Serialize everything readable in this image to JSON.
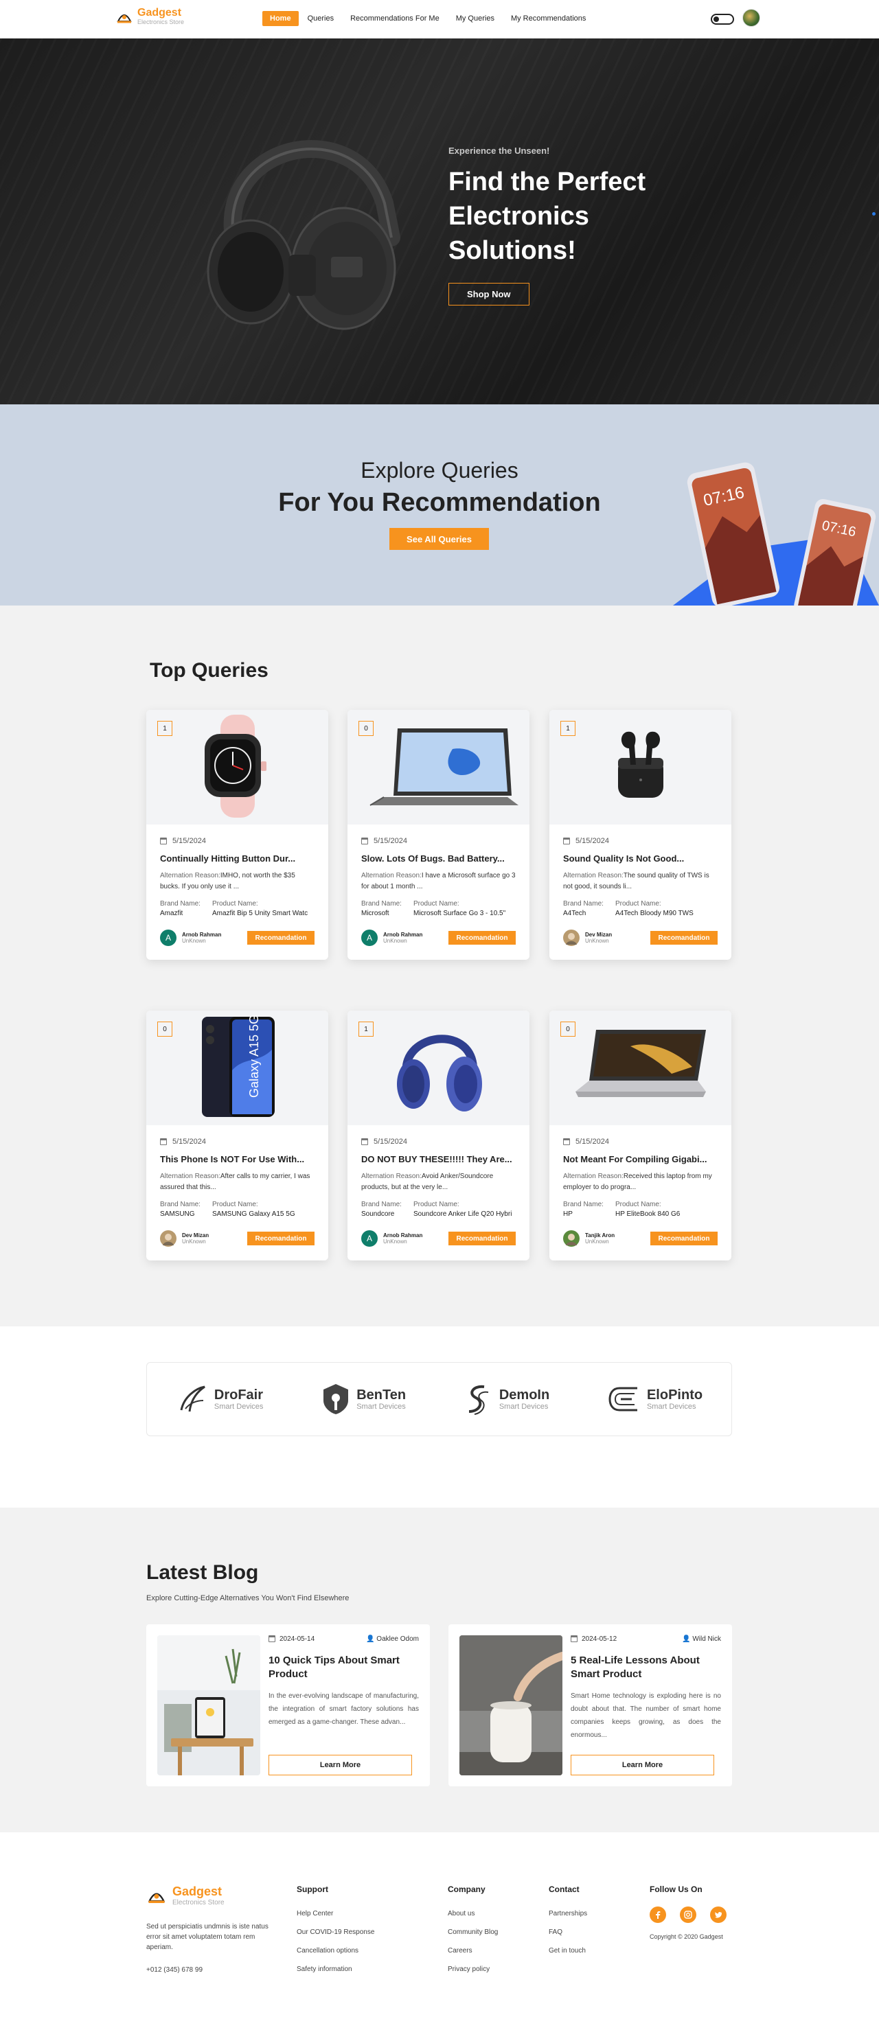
{
  "brand": {
    "name": "Gadgest",
    "tagline": "Electronics Store"
  },
  "nav": {
    "items": [
      {
        "label": "Home",
        "active": true
      },
      {
        "label": "Queries"
      },
      {
        "label": "Recommendations For Me"
      },
      {
        "label": "My Queries"
      },
      {
        "label": "My Recommendations"
      }
    ]
  },
  "hero": {
    "kicker": "Experience the Unseen!",
    "title": "Find the Perfect Electronics Solutions!",
    "button": "Shop Now"
  },
  "explore": {
    "subtitle": "Explore Queries",
    "title": "For You Recommendation",
    "button": "See All Queries",
    "phone_time": "07:16"
  },
  "queries": {
    "title": "Top Queries",
    "brand_label": "Brand Name:",
    "product_label": "Product Name:",
    "reason_label": "Alternation Reason:",
    "button_label": "Recomandation",
    "cards": [
      {
        "count": "1",
        "date": "5/15/2024",
        "title": "Continually Hitting Button Dur...",
        "reason": "IMHO, not worth the $35 bucks. If you only use it ...",
        "brand": "Amazfit",
        "product": "Amazfit Bip 5 Unity Smart Watc",
        "user": "Arnob Rahman",
        "role": "UnKnown",
        "avatar_letter": "A",
        "icon": "smartwatch-icon"
      },
      {
        "count": "0",
        "date": "5/15/2024",
        "title": "Slow. Lots Of Bugs. Bad Battery...",
        "reason": "I have a Microsoft surface go 3 for about 1 month ...",
        "brand": "Microsoft",
        "product": "Microsoft Surface Go 3 - 10.5\"",
        "user": "Arnob Rahman",
        "role": "UnKnown",
        "avatar_letter": "A",
        "icon": "tablet-icon"
      },
      {
        "count": "1",
        "date": "5/15/2024",
        "title": "Sound Quality Is Not Good...",
        "reason": "The sound quality of TWS is not good, it sounds li...",
        "brand": "A4Tech",
        "product": "A4Tech Bloody M90 TWS",
        "user": "Dev Mizan",
        "role": "UnKnown",
        "avatar_letter": "",
        "icon": "earbuds-icon"
      },
      {
        "count": "0",
        "date": "5/15/2024",
        "title": "This Phone Is NOT For Use With...",
        "reason": "After calls to my carrier, I was assured that this...",
        "brand": "SAMSUNG",
        "product": "SAMSUNG Galaxy A15 5G",
        "user": "Dev Mizan",
        "role": "UnKnown",
        "avatar_letter": "",
        "icon": "smartphone-icon"
      },
      {
        "count": "1",
        "date": "5/15/2024",
        "title": "DO NOT BUY THESE!!!!! They Are...",
        "reason": "Avoid Anker/Soundcore products, but at the very le...",
        "brand": "Soundcore",
        "product": "Soundcore Anker Life Q20 Hybri",
        "user": "Arnob Rahman",
        "role": "UnKnown",
        "avatar_letter": "A",
        "icon": "headphones-icon"
      },
      {
        "count": "0",
        "date": "5/15/2024",
        "title": "Not Meant For Compiling Gigabi...",
        "reason": "Received this laptop from my employer to do progra...",
        "brand": "HP",
        "product": "HP EliteBook 840 G6",
        "user": "Tanjik Aron",
        "role": "UnKnown",
        "avatar_letter": "",
        "icon": "laptop-icon"
      }
    ]
  },
  "brands": [
    {
      "name": "DroFair",
      "sub": "Smart Devices"
    },
    {
      "name": "BenTen",
      "sub": "Smart Devices"
    },
    {
      "name": "DemoIn",
      "sub": "Smart Devices"
    },
    {
      "name": "EloPinto",
      "sub": "Smart Devices"
    }
  ],
  "blog": {
    "title": "Latest Blog",
    "subtitle": "Explore Cutting-Edge Alternatives You Won't Find Elsewhere",
    "posts": [
      {
        "date": "2024-05-14",
        "author": "Oaklee Odom",
        "title": "10 Quick Tips About Smart Product",
        "excerpt": "In the ever-evolving landscape of manufacturing, the integration of smart factory solutions has emerged as a game-changer. These advan...",
        "button": "Learn More"
      },
      {
        "date": "2024-05-12",
        "author": "Wild Nick",
        "title": "5 Real-Life Lessons About Smart Product",
        "excerpt": "Smart Home technology is exploding here is no doubt about that. The number of smart home companies keeps growing, as does the enormous...",
        "button": "Learn More"
      }
    ]
  },
  "footer": {
    "brand": "Gadgest",
    "tagline": "Electronics Store",
    "description": "Sed ut perspiciatis undmnis is iste natus error sit amet voluptatem totam rem aperiam.",
    "phone": "+012 (345) 678 99",
    "support": {
      "title": "Support",
      "links": [
        "Help Center",
        "Our COVID-19 Response",
        "Cancellation options",
        "Safety information"
      ]
    },
    "company": {
      "title": "Company",
      "links": [
        "About us",
        "Community Blog",
        "Careers",
        "Privacy policy"
      ]
    },
    "contact": {
      "title": "Contact",
      "links": [
        "Partnerships",
        "FAQ",
        "Get in touch"
      ]
    },
    "follow": {
      "title": "Follow Us On"
    },
    "copyright": "Copyright © 2020 Gadgest"
  },
  "colors": {
    "accent": "#f7931e",
    "dark": "#222222",
    "banner": "#cbd5e3",
    "section_bg": "#f2f2f2"
  }
}
